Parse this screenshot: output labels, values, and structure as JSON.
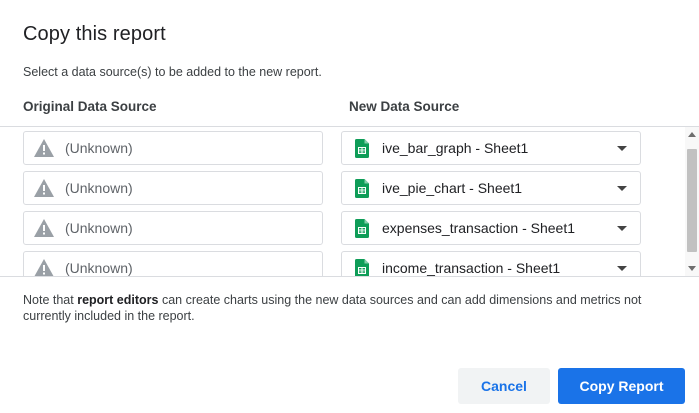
{
  "dialog": {
    "title": "Copy this report",
    "subtitle": "Select a data source(s) to be added to the new report."
  },
  "columns": {
    "original": "Original Data Source",
    "new": "New Data Source"
  },
  "rows": [
    {
      "original": "(Unknown)",
      "new": "ive_bar_graph - Sheet1"
    },
    {
      "original": "(Unknown)",
      "new": "ive_pie_chart - Sheet1"
    },
    {
      "original": "(Unknown)",
      "new": "expenses_transaction - Sheet1"
    },
    {
      "original": "(Unknown)",
      "new": "income_transaction - Sheet1"
    }
  ],
  "note": {
    "prefix": "Note that ",
    "bold": "report editors",
    "suffix": " can create charts using the new data sources and can add dimensions and metrics not currently included in the report."
  },
  "buttons": {
    "cancel": "Cancel",
    "copy": "Copy Report"
  },
  "icons": {
    "original": "warning-icon",
    "new": "google-sheets-icon",
    "dropdown": "caret-down-icon"
  },
  "colors": {
    "accent": "#1a73e8",
    "sheets_green": "#0f9d58",
    "warning_gray": "#9aa0a6"
  }
}
